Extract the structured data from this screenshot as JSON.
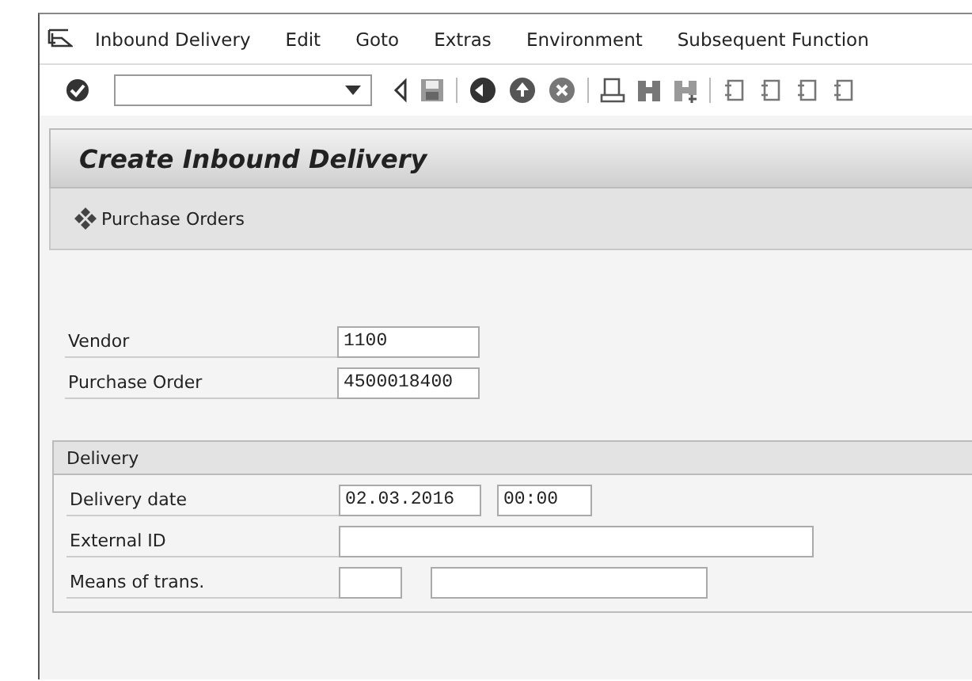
{
  "menu_bar": [
    "Inbound Delivery",
    "Edit",
    "Goto",
    "Extras",
    "Environment",
    "Subsequent Function"
  ],
  "title": "Create Inbound Delivery",
  "app_toolbar": {
    "button": "Purchase Orders"
  },
  "fields": [
    {
      "label": "Vendor",
      "value": "1100",
      "kind": "short"
    },
    {
      "label": "Purchase Order",
      "value": "4500018400",
      "kind": "short"
    }
  ],
  "delivery_group": {
    "title": "Delivery",
    "rows": [
      {
        "label": "Delivery date",
        "values": [
          "02.03.2016",
          "00:00"
        ],
        "kind": "datetime"
      },
      {
        "label": "External ID",
        "kind": "long"
      },
      {
        "label": "Means of trans.",
        "kind": "pair"
      }
    ]
  }
}
